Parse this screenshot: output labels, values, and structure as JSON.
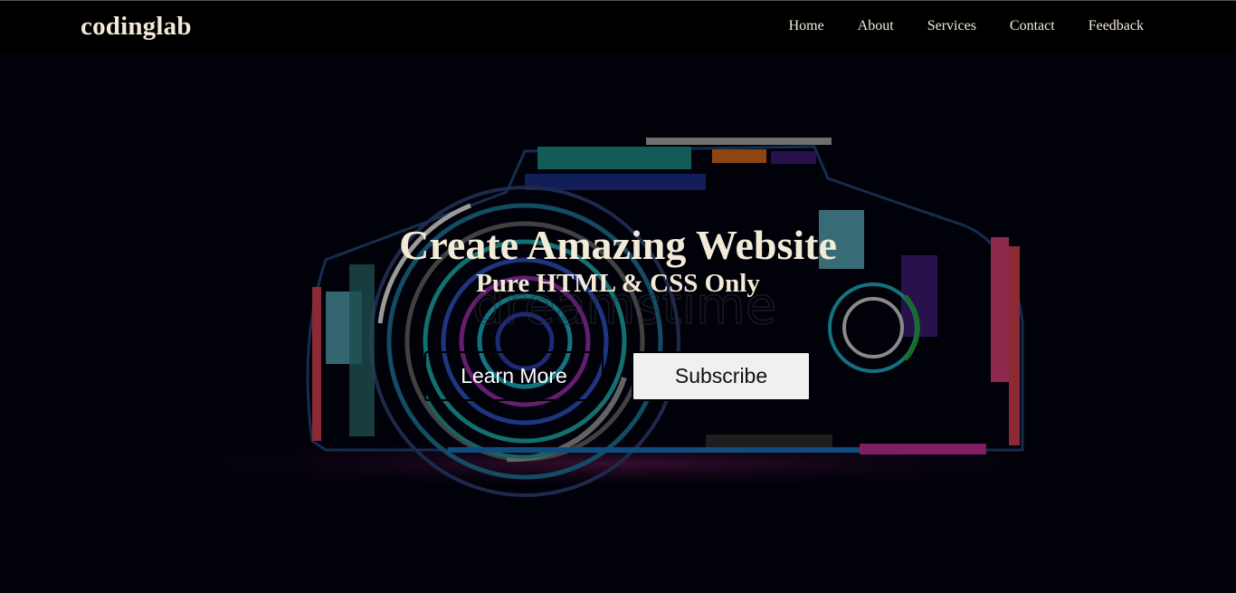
{
  "navbar": {
    "brand": "codinglab",
    "links": [
      "Home",
      "About",
      "Services",
      "Contact",
      "Feedback"
    ]
  },
  "hero": {
    "title": "Create Amazing Website",
    "subtitle": "Pure HTML & CSS Only",
    "buttons": {
      "learn_more": "Learn More",
      "subscribe": "Subscribe"
    },
    "background_image": "neon line-art camera illustration"
  },
  "colors": {
    "navbar_bg": "#000000",
    "page_bg": "#02020e",
    "text_cream": "#f3ead7",
    "subscribe_bg": "#f0f0f0"
  }
}
